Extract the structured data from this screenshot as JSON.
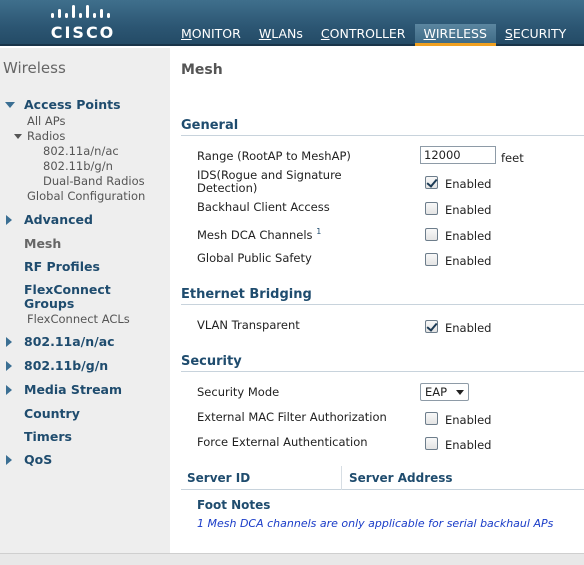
{
  "header": {
    "logo_text": "CISCO",
    "nav": [
      {
        "underline": "M",
        "rest": "ONITOR",
        "active": false
      },
      {
        "underline": "W",
        "rest": "LANs",
        "active": false
      },
      {
        "underline": "C",
        "rest": "ONTROLLER",
        "active": false
      },
      {
        "underline": "W",
        "rest": "IRELESS",
        "active": true
      },
      {
        "underline": "S",
        "rest": "ECURITY",
        "active": false
      }
    ]
  },
  "sidebar": {
    "title": "Wireless",
    "access_points": "Access Points",
    "all_aps": "All APs",
    "radios": "Radios",
    "radio_80211anac": "802.11a/n/ac",
    "radio_80211bgn": "802.11b/g/n",
    "dual_band": "Dual-Band Radios",
    "global_config": "Global Configuration",
    "advanced": "Advanced",
    "mesh": "Mesh",
    "rf_profiles": "RF Profiles",
    "flexconnect_groups_1": "FlexConnect",
    "flexconnect_groups_2": "Groups",
    "flexconnect_acls": "FlexConnect ACLs",
    "nav_80211anac": "802.11a/n/ac",
    "nav_80211bgn": "802.11b/g/n",
    "media_stream": "Media Stream",
    "country": "Country",
    "timers": "Timers",
    "qos": "QoS"
  },
  "main": {
    "page_title": "Mesh",
    "general": {
      "title": "General",
      "range_label": "Range (RootAP to MeshAP)",
      "range_value": "12000",
      "range_unit": "feet",
      "ids_label_1": "IDS(Rogue and Signature",
      "ids_label_2": "Detection)",
      "ids_enabled": true,
      "backhaul_label": "Backhaul Client Access",
      "backhaul_enabled": false,
      "dca_label": "Mesh DCA Channels",
      "dca_footnote_ref": "1",
      "dca_enabled": false,
      "public_safety_label": "Global Public Safety",
      "public_safety_enabled": false
    },
    "ethernet": {
      "title": "Ethernet Bridging",
      "vlan_label": "VLAN Transparent",
      "vlan_enabled": true
    },
    "security": {
      "title": "Security",
      "mode_label": "Security Mode",
      "mode_value": "EAP",
      "mac_filter_label": "External MAC Filter Authorization",
      "mac_filter_enabled": false,
      "force_auth_label": "Force External Authentication",
      "force_auth_enabled": false
    },
    "enabled_text": "Enabled",
    "server_table": {
      "col_id": "Server ID",
      "col_address": "Server Address"
    },
    "footnotes": {
      "title": "Foot Notes",
      "note_1": "1 Mesh DCA channels are only applicable for serial backhaul APs"
    }
  }
}
